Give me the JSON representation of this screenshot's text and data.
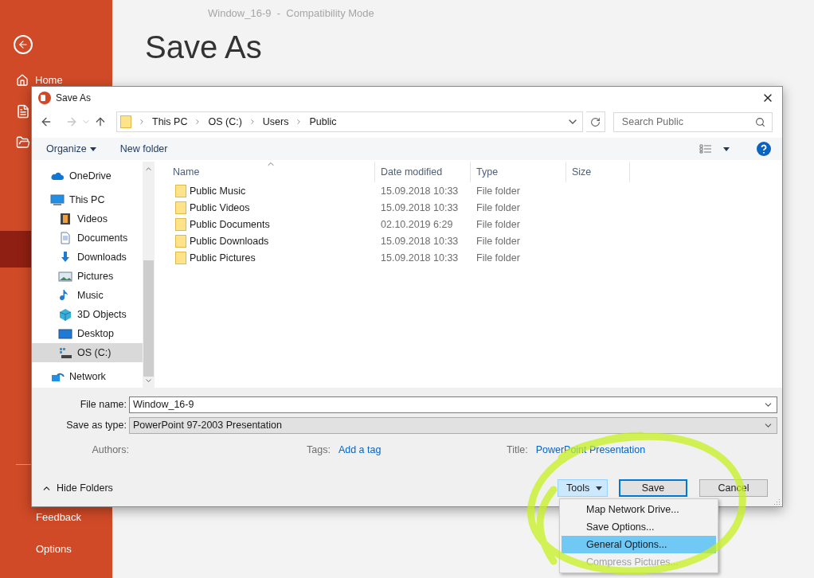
{
  "backstage": {
    "doc_title": "Window_16-9  -  Compatibility Mode",
    "heading": "Save As",
    "nav_items": [
      {
        "kind": "home",
        "label": "Home",
        "selected": false
      },
      {
        "kind": "new",
        "selected": false
      },
      {
        "kind": "open",
        "selected": false
      },
      {
        "kind": "blank",
        "selected": false
      },
      {
        "kind": "blank",
        "selected": false
      },
      {
        "kind": "blank",
        "selected": true
      }
    ],
    "nav_bottom": [
      {
        "label": "Feedback"
      },
      {
        "label": "Options"
      }
    ]
  },
  "dialog": {
    "title": "Save As",
    "breadcrumb": [
      "This PC",
      "OS (C:)",
      "Users",
      "Public"
    ],
    "search": {
      "placeholder": "Search Public"
    },
    "toolbar": {
      "organize": "Organize",
      "new_folder": "New folder"
    },
    "nav_tree": [
      {
        "kind": "cloud",
        "label": "OneDrive",
        "selected": false
      },
      {
        "kind": "pc",
        "label": "This PC",
        "selected": false,
        "children": [
          {
            "kind": "videos",
            "label": "Videos",
            "selected": false
          },
          {
            "kind": "documents",
            "label": "Documents",
            "selected": false
          },
          {
            "kind": "downloads",
            "label": "Downloads",
            "selected": false
          },
          {
            "kind": "pictures",
            "label": "Pictures",
            "selected": false
          },
          {
            "kind": "music",
            "label": "Music",
            "selected": false
          },
          {
            "kind": "objects",
            "label": "3D Objects",
            "selected": false
          },
          {
            "kind": "desktop",
            "label": "Desktop",
            "selected": false
          },
          {
            "kind": "drive",
            "label": "OS (C:)",
            "selected": true
          }
        ]
      },
      {
        "kind": "network",
        "label": "Network",
        "selected": false
      }
    ],
    "table": {
      "columns": [
        "Name",
        "Date modified",
        "Type",
        "Size"
      ],
      "rows": [
        {
          "name": "Public Music",
          "date": "15.09.2018 10:33",
          "type": "File folder"
        },
        {
          "name": "Public Videos",
          "date": "15.09.2018 10:33",
          "type": "File folder"
        },
        {
          "name": "Public Documents",
          "date": "02.10.2019 6:29",
          "type": "File folder"
        },
        {
          "name": "Public Downloads",
          "date": "15.09.2018 10:33",
          "type": "File folder"
        },
        {
          "name": "Public Pictures",
          "date": "15.09.2018 10:33",
          "type": "File folder"
        }
      ]
    },
    "file_name": {
      "label": "File name:",
      "value": "Window_16-9"
    },
    "save_type": {
      "label": "Save as type:",
      "value": "PowerPoint 97-2003 Presentation"
    },
    "meta": [
      {
        "label": "Authors:"
      },
      {
        "label": "Tags:",
        "value": "Add a tag"
      },
      {
        "label": "Title:",
        "value": "PowerPoint Presentation"
      }
    ],
    "hide_folders": "Hide Folders",
    "buttons": [
      {
        "kind": "tools",
        "label": "Tools"
      },
      {
        "kind": "save",
        "label": "Save"
      },
      {
        "kind": "cancel",
        "label": "Cancel"
      }
    ],
    "tools_menu": [
      {
        "label": "Map Network Drive...",
        "selected": false,
        "disabled": false
      },
      {
        "label": "Save Options...",
        "selected": false,
        "disabled": false
      },
      {
        "label": "General Options...",
        "selected": true,
        "disabled": false
      },
      {
        "label": "Compress Pictures...",
        "selected": false,
        "disabled": true
      }
    ]
  }
}
